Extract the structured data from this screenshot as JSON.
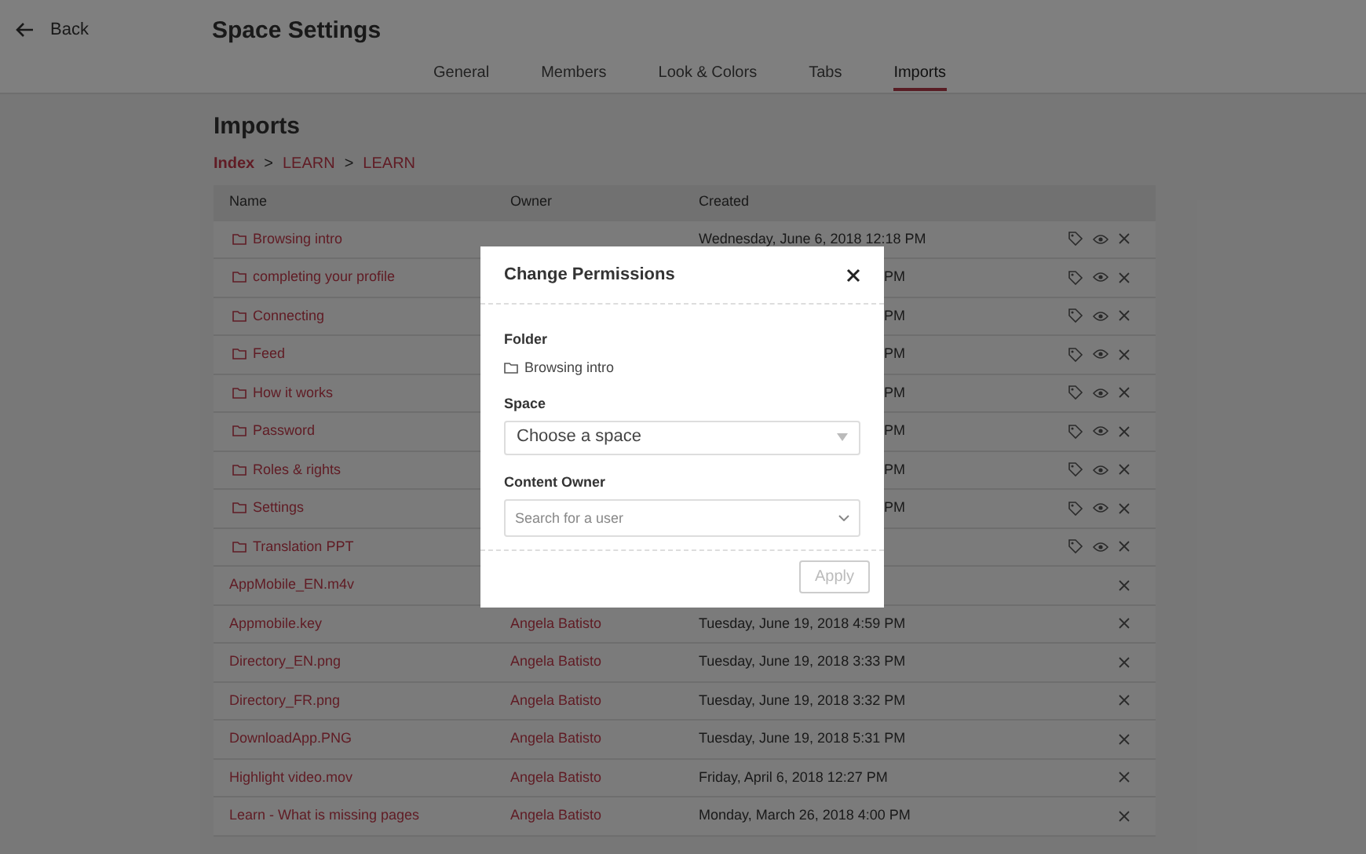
{
  "back": "Back",
  "title": "Space Settings",
  "tabs": [
    {
      "label": "General",
      "selected": false
    },
    {
      "label": "Members",
      "selected": false
    },
    {
      "label": "Look & Colors",
      "selected": false
    },
    {
      "label": "Tabs",
      "selected": false
    },
    {
      "label": "Imports",
      "selected": true
    }
  ],
  "section_title": "Imports",
  "breadcrumb": [
    {
      "kind": "link",
      "text": "Index"
    },
    {
      "kind": "separator",
      "text": ">"
    },
    {
      "kind": "link",
      "text": "LEARN"
    },
    {
      "kind": "separator",
      "text": ">"
    },
    {
      "kind": "link",
      "text": "LEARN"
    }
  ],
  "table": {
    "columns": [
      "Name",
      "Owner",
      "Created"
    ],
    "rows": [
      {
        "kind": "folder",
        "name": "Browsing intro",
        "created": "Wednesday, June 6, 2018 12:18 PM"
      },
      {
        "kind": "folder",
        "name": "completing your profile",
        "created": "PM"
      },
      {
        "kind": "folder",
        "name": "Connecting",
        "created": "PM"
      },
      {
        "kind": "folder",
        "name": "Feed",
        "created": "PM"
      },
      {
        "kind": "folder",
        "name": "How it works",
        "created": "PM"
      },
      {
        "kind": "folder",
        "name": "Password",
        "created": "PM"
      },
      {
        "kind": "folder",
        "name": "Roles & rights",
        "created": "PM"
      },
      {
        "kind": "folder",
        "name": "Settings",
        "created": "PM"
      },
      {
        "kind": "folder",
        "name": "Translation PPT"
      },
      {
        "kind": "file",
        "name": "AppMobile_EN.m4v"
      },
      {
        "kind": "file",
        "name": "Appmobile.key",
        "owner": "Angela Batisto",
        "created": "Tuesday, June 19, 2018 4:59 PM"
      },
      {
        "kind": "file",
        "name": "Directory_EN.png",
        "owner": "Angela Batisto",
        "created": "Tuesday, June 19, 2018 3:33 PM"
      },
      {
        "kind": "file",
        "name": "Directory_FR.png",
        "owner": "Angela Batisto",
        "created": "Tuesday, June 19, 2018 3:32 PM"
      },
      {
        "kind": "file",
        "name": "DownloadApp.PNG",
        "owner": "Angela Batisto",
        "created": "Tuesday, June 19, 2018 5:31 PM"
      },
      {
        "kind": "file",
        "name": "Highlight video.mov",
        "owner": "Angela Batisto",
        "created": "Friday, April 6, 2018 12:27 PM"
      },
      {
        "kind": "file",
        "name": "Learn - What is missing pages",
        "owner": "Angela Batisto",
        "created": "Monday, March 26, 2018 4:00 PM"
      }
    ]
  },
  "modal": {
    "title": "Change Permissions",
    "folder_label": "Folder",
    "folder_name": "Browsing intro",
    "space_label": "Space",
    "space_value": "Choose a space",
    "owner_label": "Content Owner",
    "owner_placeholder": "Search for a user",
    "apply": "Apply",
    "apply_disabled": true
  }
}
